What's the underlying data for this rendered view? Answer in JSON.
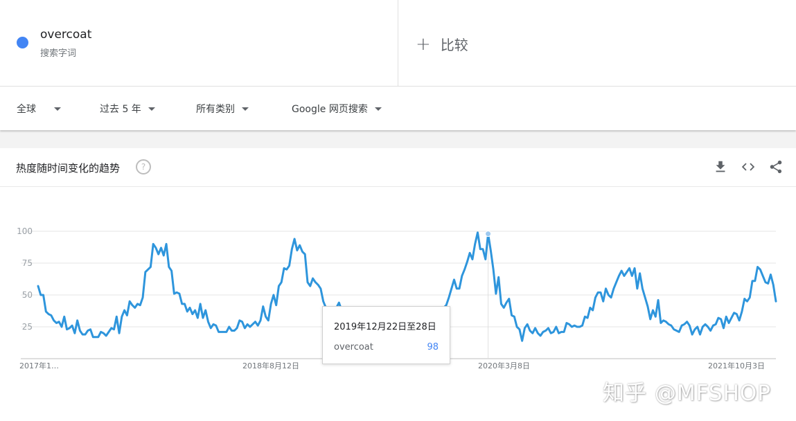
{
  "search": {
    "term": "overcoat",
    "term_type": "搜索字词",
    "term_color": "#4285f4",
    "compare_label": "比较"
  },
  "filters": {
    "region": "全球",
    "time_range": "过去 5 年",
    "category": "所有类别",
    "search_type": "Google 网页搜索"
  },
  "card": {
    "title": "热度随时间变化的趋势",
    "help": "?",
    "icons": [
      "download-icon",
      "embed-code-icon",
      "share-icon"
    ]
  },
  "tooltip": {
    "date": "2019年12月22日至28日",
    "term": "overcoat",
    "value": "98"
  },
  "watermark": "知乎 @MFSHOP",
  "chart_data": {
    "type": "line",
    "y_ticks": [
      "100",
      "75",
      "50",
      "25"
    ],
    "x_tick_labels": [
      "2017年1…",
      "2018年8月12日",
      "2020年3月8日",
      "2021年10月3日"
    ],
    "ylim": [
      0,
      100
    ],
    "grid": true,
    "series": [
      {
        "name": "overcoat",
        "color": "#2e95dc",
        "values": [
          57,
          50,
          50,
          37,
          35,
          34,
          30,
          28,
          29,
          25,
          33,
          23,
          24,
          26,
          20,
          30,
          22,
          19,
          19,
          22,
          23,
          17,
          17,
          17,
          21,
          20,
          18,
          21,
          24,
          23,
          33,
          20,
          33,
          38,
          34,
          45,
          42,
          40,
          43,
          42,
          48,
          68,
          70,
          72,
          90,
          87,
          82,
          87,
          81,
          90,
          72,
          69,
          51,
          52,
          51,
          43,
          43,
          37,
          40,
          35,
          38,
          32,
          43,
          32,
          38,
          29,
          24,
          27,
          26,
          21,
          21,
          21,
          21,
          25,
          22,
          22,
          24,
          30,
          29,
          24,
          27,
          25,
          27,
          29,
          26,
          30,
          41,
          33,
          30,
          43,
          50,
          42,
          57,
          60,
          71,
          70,
          73,
          86,
          94,
          85,
          89,
          84,
          82,
          60,
          57,
          63,
          60,
          58,
          55,
          45,
          40,
          40,
          38,
          36,
          40,
          44,
          38,
          35,
          32,
          29,
          25,
          26,
          28,
          25,
          24,
          21,
          20,
          22,
          24,
          20,
          21,
          22,
          28,
          35,
          36,
          30,
          25,
          20,
          18,
          16,
          20,
          24,
          25,
          22,
          20,
          28,
          25,
          22,
          19,
          21,
          20,
          23,
          25,
          30,
          36,
          40,
          42,
          48,
          55,
          62,
          55,
          55,
          65,
          70,
          76,
          83,
          78,
          90,
          99,
          86,
          86,
          78,
          98,
          85,
          70,
          51,
          64,
          43,
          40,
          44,
          47,
          34,
          33,
          25,
          23,
          14,
          24,
          27,
          22,
          20,
          24,
          20,
          18,
          21,
          22,
          24,
          20,
          21,
          25,
          20,
          21,
          21,
          28,
          27,
          25,
          26,
          25,
          25,
          26,
          33,
          32,
          40,
          38,
          48,
          52,
          52,
          45,
          55,
          50,
          48,
          55,
          60,
          65,
          69,
          65,
          68,
          71,
          65,
          71,
          55,
          67,
          55,
          48,
          41,
          31,
          38,
          33,
          46,
          28,
          30,
          29,
          27,
          26,
          23,
          22,
          21,
          26,
          27,
          29,
          26,
          19,
          23,
          25,
          19,
          25,
          27,
          25,
          22,
          26,
          27,
          32,
          31,
          24,
          33,
          28,
          32,
          36,
          35,
          30,
          37,
          47,
          45,
          48,
          61,
          61,
          72,
          70,
          65,
          60,
          59,
          66,
          58,
          45
        ]
      }
    ]
  }
}
